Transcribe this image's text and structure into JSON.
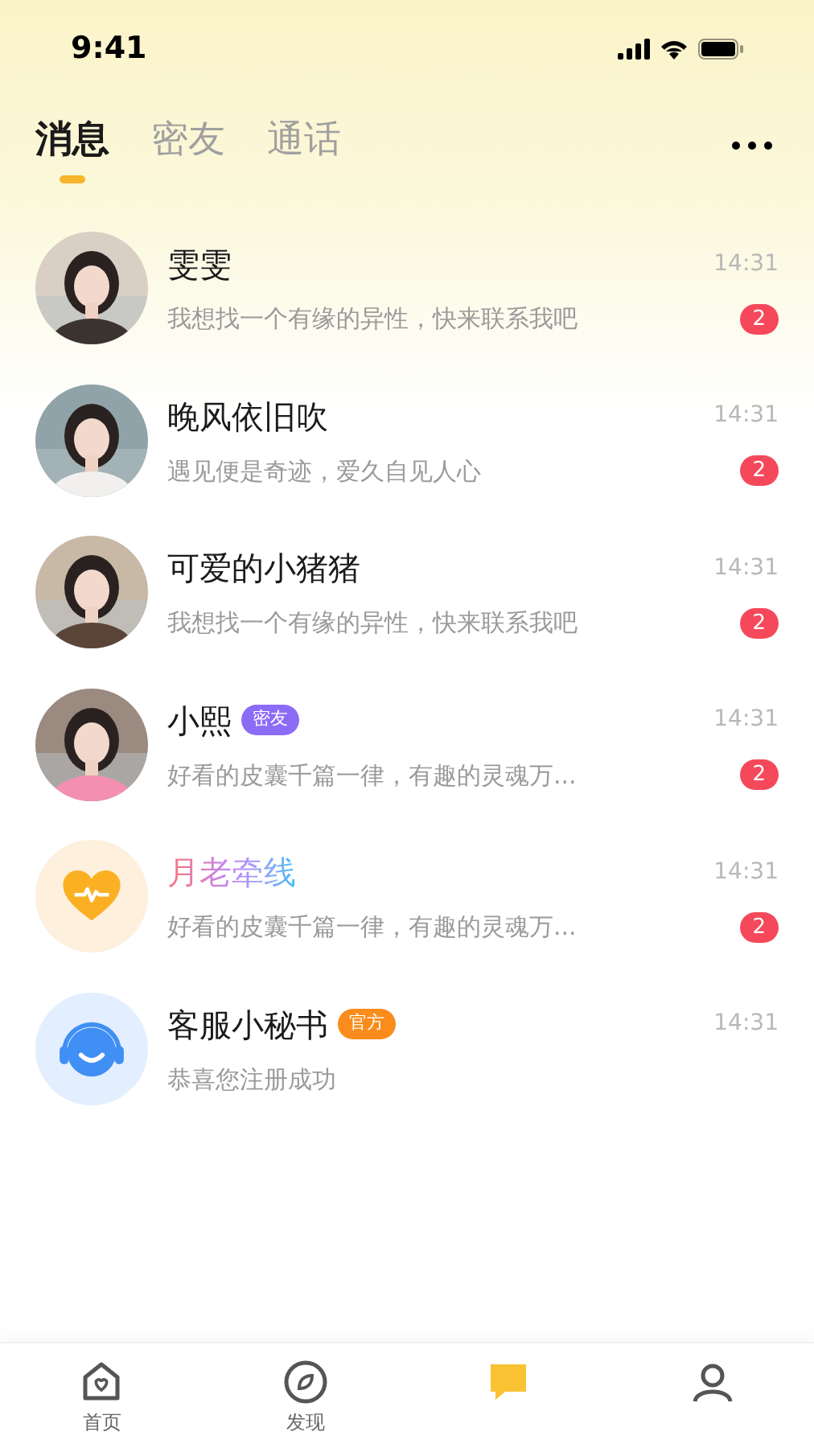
{
  "status_bar": {
    "time": "9:41"
  },
  "tabs": [
    {
      "label": "消息",
      "selected": true
    },
    {
      "label": "密友",
      "selected": false
    },
    {
      "label": "通话",
      "selected": false
    }
  ],
  "conversations": [
    {
      "kind": "picture",
      "name": "雯雯",
      "time": "14:31",
      "preview": "我想找一个有缘的异性，快来联系我吧",
      "unread": "2"
    },
    {
      "kind": "picture",
      "name": "晚风依旧吹",
      "time": "14:31",
      "preview": "遇见便是奇迹，爱久自见人心",
      "unread": "2"
    },
    {
      "kind": "picture",
      "name": "可爱的小猪猪",
      "time": "14:31",
      "preview": "我想找一个有缘的异性，快来联系我吧",
      "unread": "2"
    },
    {
      "kind": "picture",
      "name": "小熙",
      "tag": {
        "label": "密友",
        "color": "#8b6cf6"
      },
      "time": "14:31",
      "preview": "好看的皮囊千篇一律，有趣的灵魂万...",
      "unread": "2"
    },
    {
      "kind": "matchmaker",
      "name": "月老牵线",
      "time": "14:31",
      "preview": "好看的皮囊千篇一律，有趣的灵魂万...",
      "unread": "2"
    },
    {
      "kind": "service",
      "name": "客服小秘书",
      "tag": {
        "label": "官方",
        "color": "#f98c1d"
      },
      "time": "14:31",
      "preview": "恭喜您注册成功"
    }
  ],
  "bottom_nav": [
    {
      "label": "首页",
      "selected": false
    },
    {
      "label": "发现",
      "selected": false
    },
    {
      "selected": true
    },
    {
      "selected": false
    }
  ]
}
